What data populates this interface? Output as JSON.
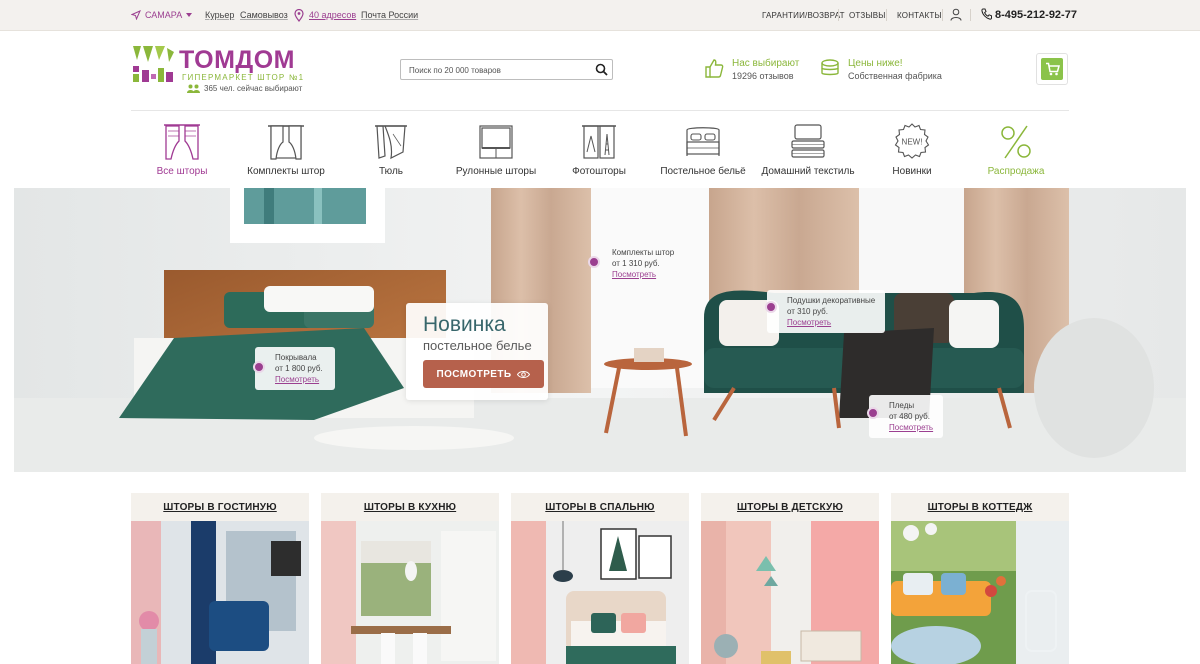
{
  "topbar": {
    "city": "САМАРА",
    "delivery_links": [
      "Курьер",
      "Самовывоз",
      "40 адресов",
      "Почта России"
    ],
    "right_links": [
      "ГАРАНТИИ/ВОЗВРАТ",
      "ОТЗЫВЫ",
      "КОНТАКТЫ"
    ],
    "phone": "8-495-212-92-77"
  },
  "header": {
    "logo_title": "ТОМДОМ",
    "logo_subtitle": "гипермаркет штор №1",
    "visitors": "365 чел. сейчас выбирают",
    "search_placeholder": "Поиск по 20 000 товаров",
    "features": [
      {
        "title": "Нас выбирают",
        "subtitle": "19296 отзывов",
        "icon": "thumbs-up-icon"
      },
      {
        "title": "Цены ниже!",
        "subtitle": "Собственная фабрика",
        "icon": "fabric-roll-icon"
      }
    ]
  },
  "categories": [
    {
      "label": "Все шторы",
      "icon": "curtains-icon"
    },
    {
      "label": "Комплекты штор",
      "icon": "curtain-set-icon"
    },
    {
      "label": "Тюль",
      "icon": "tulle-icon"
    },
    {
      "label": "Рулонные шторы",
      "icon": "roller-blind-icon"
    },
    {
      "label": "Фотошторы",
      "icon": "photo-curtain-icon"
    },
    {
      "label": "Постельное бельё",
      "icon": "bed-icon"
    },
    {
      "label": "Домашний текстиль",
      "icon": "towels-icon"
    },
    {
      "label": "Новинки",
      "icon": "new-badge-icon"
    },
    {
      "label": "Распродажа",
      "icon": "percent-icon"
    }
  ],
  "banner": {
    "promo_title": "Новинка",
    "promo_subtitle": "постельное белье",
    "promo_button": "ПОСМОТРЕТЬ",
    "hotspots": [
      {
        "name": "Комплекты штор",
        "price": "от 1 310 руб.",
        "link": "Посмотреть"
      },
      {
        "name": "Подушки декоративные",
        "price": "от 310 руб.",
        "link": "Посмотреть"
      },
      {
        "name": "Покрывала",
        "price": "от 1 800 руб.",
        "link": "Посмотреть"
      },
      {
        "name": "Пледы",
        "price": "от 480 руб.",
        "link": "Посмотреть"
      }
    ]
  },
  "rooms": [
    {
      "title": "ШТОРЫ В ГОСТИНУЮ"
    },
    {
      "title": "ШТОРЫ В КУХНЮ"
    },
    {
      "title": "ШТОРЫ В СПАЛЬНЮ"
    },
    {
      "title": "ШТОРЫ В ДЕТСКУЮ"
    },
    {
      "title": "ШТОРЫ В КОТТЕДЖ"
    }
  ],
  "colors": {
    "brand_purple": "#a03a93",
    "brand_green": "#8bb73b",
    "button_terracotta": "#b6614c",
    "teal_text": "#37666b"
  }
}
